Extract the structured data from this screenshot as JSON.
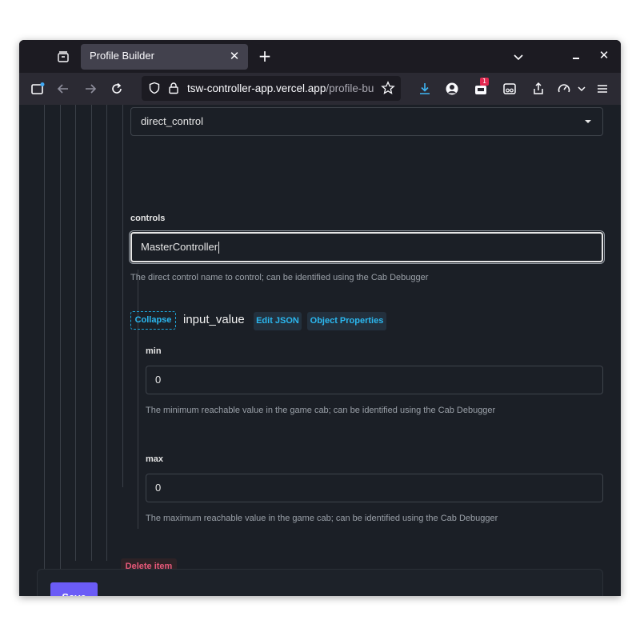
{
  "browser": {
    "tab_title": "Profile Builder",
    "url_host": "tsw-controller-app.vercel.app",
    "url_path": "/profile-bu",
    "notification_badge": "1",
    "icons": [
      "tab-overview-icon",
      "close-icon",
      "plus-icon",
      "chevron-down-icon",
      "minimize-icon",
      "window-close-icon",
      "sidebar-icon",
      "back-icon",
      "forward-icon",
      "reload-icon",
      "shield-icon",
      "lock-icon",
      "star-icon",
      "download-icon",
      "account-icon",
      "extension-icon",
      "container-icon",
      "share-icon",
      "speed-icon",
      "menu-icon"
    ]
  },
  "form": {
    "select_value": "direct_control",
    "controls_label": "controls",
    "controls_value": "MasterController",
    "controls_help": "The direct control name to control; can be identified using the Cab Debugger",
    "collapse_label": "Collapse",
    "object_title": "input_value",
    "edit_json_label": "Edit JSON",
    "object_properties_label": "Object Properties",
    "min_label": "min",
    "min_value": "0",
    "min_help": "The minimum reachable value in the game cab; can be identified using the Cab Debugger",
    "max_label": "max",
    "max_value": "0",
    "max_help": "The maximum reachable value in the game cab; can be identified using the Cab Debugger",
    "delete_label": "Delete item",
    "save_label": "Save"
  },
  "colors": {
    "accent": "#6b5cf6",
    "link": "#2bb7ef",
    "danger": "#e8597a",
    "background": "#1b1f26"
  }
}
